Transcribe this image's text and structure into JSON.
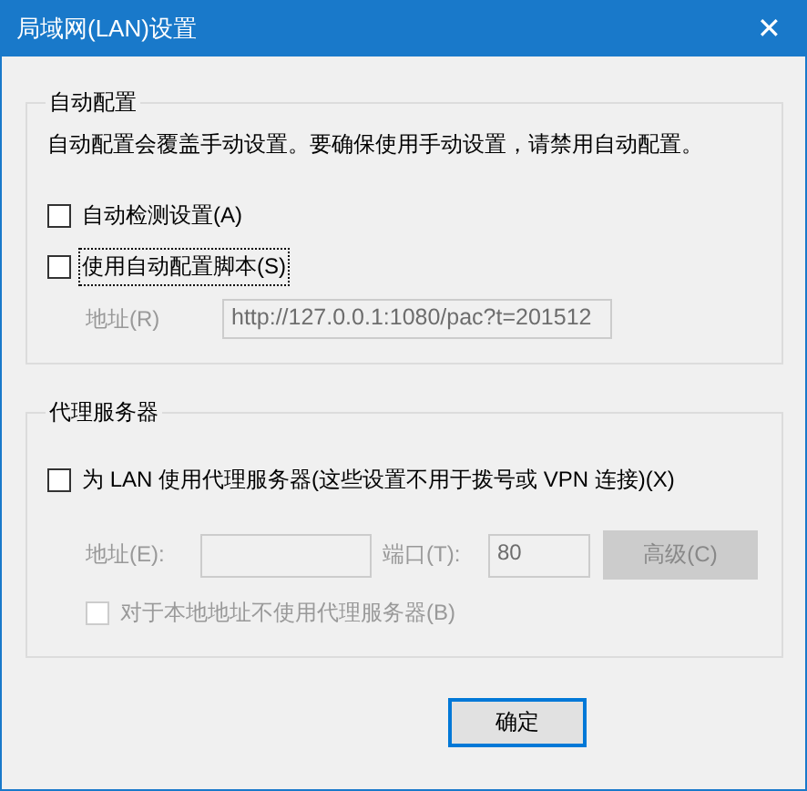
{
  "window": {
    "title": "局域网(LAN)设置",
    "close": "✕"
  },
  "auto_config": {
    "legend": "自动配置",
    "note": "自动配置会覆盖手动设置。要确保使用手动设置，请禁用自动配置。",
    "checkboxes": [
      {
        "label": "自动检测设置(A)",
        "checked": false,
        "focused": false
      },
      {
        "label": "使用自动配置脚本(S)",
        "checked": false,
        "focused": true
      }
    ],
    "address": {
      "label": "地址(R)",
      "value": "http://127.0.0.1:1080/pac?t=201512",
      "disabled": true
    }
  },
  "proxy": {
    "legend": "代理服务器",
    "use_proxy": {
      "label": "为 LAN 使用代理服务器(这些设置不用于拨号或 VPN 连接)(X)",
      "checked": false
    },
    "address": {
      "label": "地址(E):",
      "disabled": true
    },
    "port": {
      "label": "端口(T):",
      "value": "80",
      "disabled": true
    },
    "advanced": {
      "label": "高级(C)",
      "disabled": true
    },
    "bypass": {
      "label": "对于本地地址不使用代理服务器(B)",
      "checked": false,
      "disabled": true
    }
  },
  "buttons": [
    {
      "label": "确定",
      "default": true
    }
  ]
}
